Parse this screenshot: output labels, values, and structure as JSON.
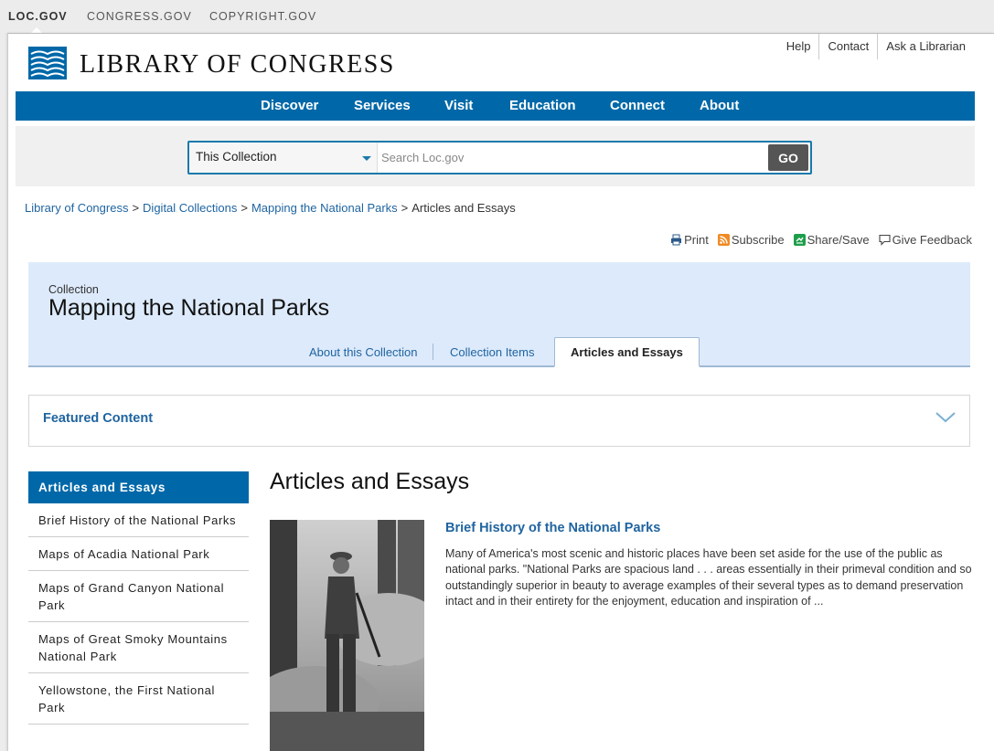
{
  "site_bar": {
    "links": [
      "LOC.GOV",
      "CONGRESS.GOV",
      "COPYRIGHT.GOV"
    ]
  },
  "header": {
    "logo_text": "LIBRARY OF CONGRESS",
    "utility_links": [
      "Help",
      "Contact",
      "Ask a Librarian"
    ]
  },
  "nav": {
    "items": [
      "Discover",
      "Services",
      "Visit",
      "Education",
      "Connect",
      "About"
    ]
  },
  "search": {
    "scope": "This Collection",
    "placeholder": "Search Loc.gov",
    "button": "GO"
  },
  "breadcrumb": {
    "items": [
      "Library of Congress",
      "Digital Collections",
      "Mapping the National Parks"
    ],
    "current": "Articles and Essays",
    "separator": ">"
  },
  "tools": {
    "print": "Print",
    "subscribe": "Subscribe",
    "share": "Share/Save",
    "feedback": "Give Feedback"
  },
  "collection": {
    "kicker": "Collection",
    "title": "Mapping the National Parks",
    "tabs": [
      "About this Collection",
      "Collection Items",
      "Articles and Essays"
    ],
    "active_tab": "Articles and Essays"
  },
  "featured": {
    "label": "Featured Content"
  },
  "sidebar": {
    "heading": "Articles and Essays",
    "items": [
      "Brief History of the National Parks",
      "Maps of Acadia National Park",
      "Maps of Grand Canyon National Park",
      "Maps of Great Smoky Mountains National Park",
      "Yellowstone, the First National Park"
    ]
  },
  "main": {
    "title": "Articles and Essays",
    "article": {
      "title": "Brief History of the National Parks",
      "description": "Many of America's most scenic and historic places have been set aside for the use of the public as national parks. \"National Parks are spacious land . . . areas essentially in their primeval condition and so outstandingly superior in beauty to average examples of their several types as to demand preservation intact and in their entirety for the enjoyment, education and inspiration of ..."
    }
  },
  "colors": {
    "brand_blue": "#0068a8",
    "link_blue": "#1f64a0",
    "banner_bg": "#ddeafb"
  }
}
